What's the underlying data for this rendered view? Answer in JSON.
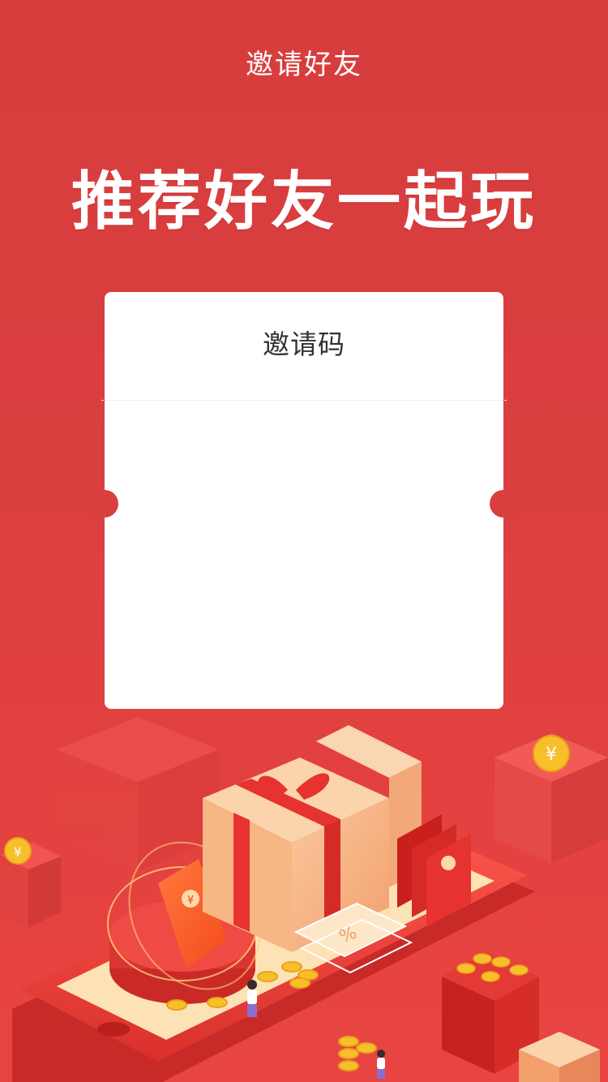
{
  "nav": {
    "title": "邀请好友"
  },
  "hero": {
    "headline": "推荐好友一起玩"
  },
  "invite_card": {
    "title": "邀请码"
  },
  "illustration": {
    "percent_symbol": "%",
    "currency_symbol": "¥"
  },
  "colors": {
    "background": "#d83d3e",
    "card": "#ffffff",
    "text_dark": "#333333",
    "gold": "#f7c02b"
  }
}
